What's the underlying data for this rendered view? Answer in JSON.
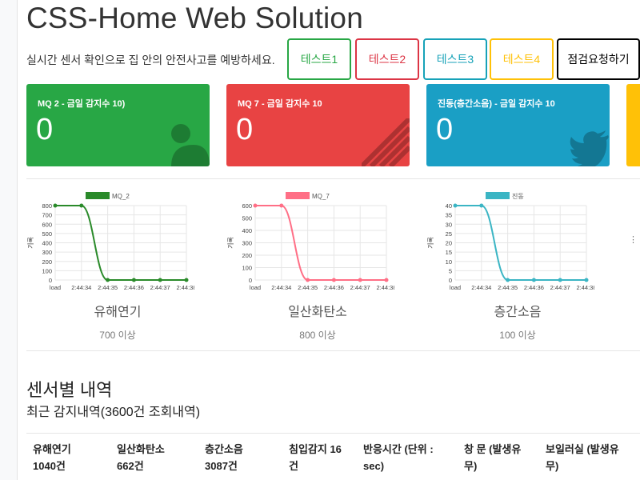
{
  "header": {
    "title": "CSS-Home Web Solution",
    "subtitle": "실시간 센서 확인으로 집 안의 안전사고를 예방하세요."
  },
  "buttons": [
    {
      "label": "테스트1",
      "color": "#28a745"
    },
    {
      "label": "테스트2",
      "color": "#dc3545"
    },
    {
      "label": "테스트3",
      "color": "#17a2b8"
    },
    {
      "label": "테스트4",
      "color": "#ffc107"
    },
    {
      "label": "점검요청하기",
      "color": "#000000"
    }
  ],
  "cards": [
    {
      "title": "MQ 2 - 금일 감지수 10)",
      "value": "0",
      "color": "#28a745",
      "icon": "user-icon"
    },
    {
      "title": "MQ 7 - 금일 감지수 10",
      "value": "0",
      "color": "#e84343",
      "icon": "stripes-icon"
    },
    {
      "title": "진동(층간소음) - 금일 감지수 10",
      "value": "0",
      "color": "#1a9fc5",
      "icon": "twitter-icon"
    },
    {
      "title": "",
      "value": "",
      "color": "#ffc107",
      "icon": ""
    }
  ],
  "charts": [
    {
      "name": "유해연기",
      "threshold": "700 이상",
      "chart_data": {
        "type": "line",
        "title": "",
        "xlabel": "",
        "ylabel": "기록",
        "categories": [
          "load",
          "2:44:34",
          "2:44:35",
          "2:44:36",
          "2:44:37",
          "2:44:38"
        ],
        "series": [
          {
            "name": "MQ_2",
            "values": [
              800,
              800,
              0,
              0,
              0,
              0
            ],
            "color": "#2a8a2a"
          }
        ],
        "ylim": [
          0,
          800
        ],
        "yticks": [
          0,
          100,
          200,
          300,
          400,
          500,
          600,
          700,
          800
        ],
        "grid": true,
        "legend": "top"
      }
    },
    {
      "name": "일산화탄소",
      "threshold": "800 이상",
      "chart_data": {
        "type": "line",
        "title": "",
        "xlabel": "",
        "ylabel": "기록",
        "categories": [
          "load",
          "2:44:34",
          "2:44:35",
          "2:44:36",
          "2:44:37",
          "2:44:38"
        ],
        "series": [
          {
            "name": "MQ_7",
            "values": [
              600,
              600,
              0,
              0,
              0,
              0
            ],
            "color": "#ff6f86"
          }
        ],
        "ylim": [
          0,
          600
        ],
        "yticks": [
          0,
          100,
          200,
          300,
          400,
          500,
          600
        ],
        "grid": true,
        "legend": "top"
      }
    },
    {
      "name": "층간소음",
      "threshold": "100 이상",
      "chart_data": {
        "type": "line",
        "title": "",
        "xlabel": "",
        "ylabel": "기록",
        "categories": [
          "load",
          "2:44:34",
          "2:44:35",
          "2:44:36",
          "2:44:37",
          "2:44:38"
        ],
        "series": [
          {
            "name": "진동",
            "values": [
              40,
              40,
              0,
              0,
              0,
              0
            ],
            "color": "#3bb5c4"
          }
        ],
        "ylim": [
          0,
          40
        ],
        "yticks": [
          0,
          5,
          10,
          15,
          20,
          25,
          30,
          35,
          40
        ],
        "grid": true,
        "legend": "top"
      }
    }
  ],
  "section": {
    "title": "센서별 내역",
    "subtitle": "최근 감지내역(3600건 조회내역)"
  },
  "table_headers": [
    [
      "유해연기",
      "1040건"
    ],
    [
      "일산화탄소",
      "662건"
    ],
    [
      "층간소음",
      "3087건"
    ],
    [
      "침입감지 16",
      "건"
    ],
    [
      "반응시간 (단위 :",
      "sec)"
    ],
    [
      "창 문 (발생유",
      "무)"
    ],
    [
      "보일러실 (발생유",
      "무)"
    ]
  ]
}
